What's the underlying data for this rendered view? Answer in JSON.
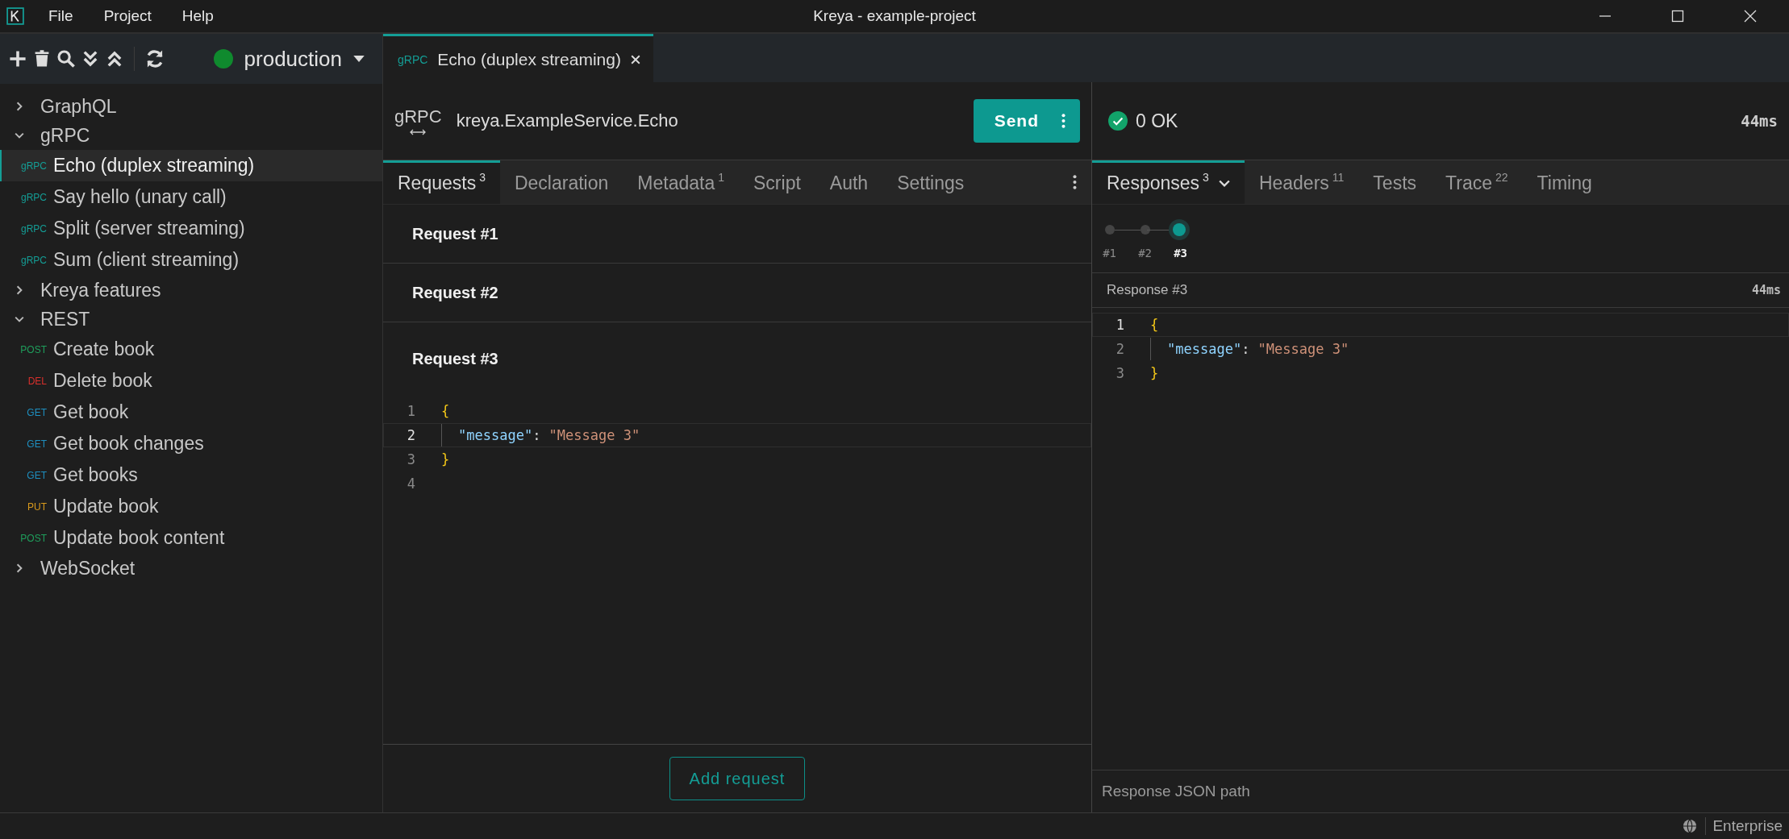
{
  "window": {
    "title": "Kreya - example-project"
  },
  "menu": [
    "File",
    "Project",
    "Help"
  ],
  "sidebar": {
    "environment": {
      "name": "production",
      "color": "#0f8a2e"
    },
    "tree": [
      {
        "label": "GraphQL",
        "expanded": false
      },
      {
        "label": "gRPC",
        "expanded": true,
        "children": [
          {
            "method": "gRPC",
            "color": "#149e96",
            "label": "Echo (duplex streaming)",
            "selected": true
          },
          {
            "method": "gRPC",
            "color": "#149e96",
            "label": "Say hello (unary call)",
            "selected": false
          },
          {
            "method": "gRPC",
            "color": "#149e96",
            "label": "Split (server streaming)",
            "selected": false
          },
          {
            "method": "gRPC",
            "color": "#149e96",
            "label": "Sum (client streaming)",
            "selected": false
          }
        ]
      },
      {
        "label": "Kreya features",
        "expanded": false
      },
      {
        "label": "REST",
        "expanded": true,
        "children": [
          {
            "method": "POST",
            "color": "#1f9e5c",
            "label": "Create book",
            "selected": false
          },
          {
            "method": "DEL",
            "color": "#d9302c",
            "label": "Delete book",
            "selected": false
          },
          {
            "method": "GET",
            "color": "#1e8fc0",
            "label": "Get book",
            "selected": false
          },
          {
            "method": "GET",
            "color": "#1e8fc0",
            "label": "Get book changes",
            "selected": false
          },
          {
            "method": "GET",
            "color": "#1e8fc0",
            "label": "Get books",
            "selected": false
          },
          {
            "method": "PUT",
            "color": "#d99a1c",
            "label": "Update book",
            "selected": false
          },
          {
            "method": "POST",
            "color": "#1f9e5c",
            "label": "Update book content",
            "selected": false
          }
        ]
      },
      {
        "label": "WebSocket",
        "expanded": false
      }
    ]
  },
  "open_tabs": [
    {
      "method": "gRPC",
      "label": "Echo (duplex streaming)",
      "selected": true
    }
  ],
  "request": {
    "type": "gRPC",
    "service": "kreya.ExampleService.Echo",
    "send_label": "Send",
    "tabs": [
      {
        "label": "Requests",
        "count": "3",
        "selected": true
      },
      {
        "label": "Declaration",
        "selected": false
      },
      {
        "label": "Metadata",
        "count": "1",
        "selected": false
      },
      {
        "label": "Script",
        "selected": false
      },
      {
        "label": "Auth",
        "selected": false
      },
      {
        "label": "Settings",
        "selected": false
      }
    ],
    "messages": [
      {
        "title": "Request #1",
        "expanded": false
      },
      {
        "title": "Request #2",
        "expanded": false
      },
      {
        "title": "Request #3",
        "expanded": true,
        "lines": [
          {
            "number": "1",
            "current": false,
            "indented": false,
            "tokens": [
              {
                "kind": "brace",
                "text": "{"
              }
            ]
          },
          {
            "number": "2",
            "current": true,
            "indented": true,
            "tokens": [
              {
                "kind": "key",
                "text": "\"message\""
              },
              {
                "kind": "punct",
                "text": ": "
              },
              {
                "kind": "string",
                "text": "\"Message 3\""
              }
            ]
          },
          {
            "number": "3",
            "current": false,
            "indented": false,
            "tokens": [
              {
                "kind": "brace",
                "text": "}"
              }
            ]
          },
          {
            "number": "4",
            "current": false,
            "indented": false
          }
        ]
      }
    ],
    "add_label": "Add request"
  },
  "response": {
    "status": "0 OK",
    "ok": true,
    "time": "44ms",
    "tabs": [
      {
        "label": "Responses",
        "count": "3",
        "selected": true,
        "dropdown": true
      },
      {
        "label": "Headers",
        "count": "11",
        "selected": false
      },
      {
        "label": "Tests",
        "selected": false
      },
      {
        "label": "Trace",
        "count": "22",
        "selected": false
      },
      {
        "label": "Timing",
        "selected": false
      }
    ],
    "timeline": [
      {
        "label": "#1",
        "selected": false
      },
      {
        "label": "#2",
        "selected": false
      },
      {
        "label": "#3",
        "selected": true
      }
    ],
    "view": {
      "title": "Response #3",
      "time": "44ms",
      "lines": [
        {
          "number": "1",
          "current": true,
          "indented": false,
          "tokens": [
            {
              "kind": "brace",
              "text": "{"
            }
          ]
        },
        {
          "number": "2",
          "current": false,
          "indented": true,
          "tokens": [
            {
              "kind": "key",
              "text": "\"message\""
            },
            {
              "kind": "punct",
              "text": ": "
            },
            {
              "kind": "string",
              "text": "\"Message 3\""
            }
          ]
        },
        {
          "number": "3",
          "current": false,
          "indented": false,
          "tokens": [
            {
              "kind": "brace",
              "text": "}"
            }
          ]
        }
      ]
    },
    "path_placeholder": "Response JSON path"
  },
  "status_bar": {
    "edition": "Enterprise"
  }
}
